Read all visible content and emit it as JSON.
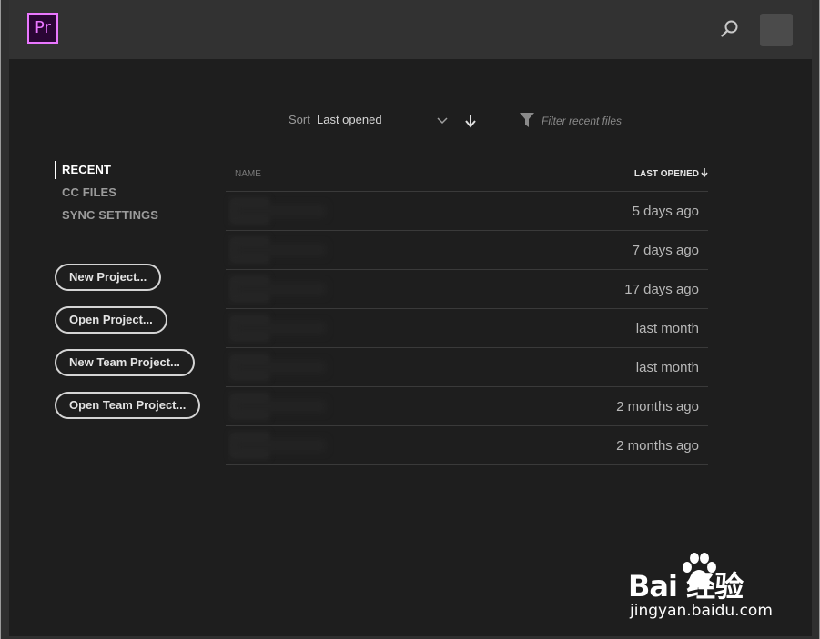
{
  "app": {
    "logo_text": "Pr",
    "accent_color": "#ea77ff"
  },
  "header": {
    "search_icon": "search-icon",
    "avatar_icon": "user-avatar"
  },
  "sort": {
    "label": "Sort",
    "selected": "Last opened",
    "direction": "descending"
  },
  "filter": {
    "placeholder": "Filter recent files"
  },
  "nav": {
    "items": [
      {
        "label": "RECENT",
        "active": true
      },
      {
        "label": "CC FILES",
        "active": false
      },
      {
        "label": "SYNC SETTINGS",
        "active": false
      }
    ]
  },
  "actions": {
    "new_project": "New Project...",
    "open_project": "Open Project...",
    "new_team_project": "New Team Project...",
    "open_team_project": "Open Team Project..."
  },
  "table": {
    "col_name": "NAME",
    "col_last_opened": "LAST OPENED",
    "rows": [
      {
        "date": "5 days ago"
      },
      {
        "date": "7 days ago"
      },
      {
        "date": "17 days ago"
      },
      {
        "date": "last month"
      },
      {
        "date": "last month"
      },
      {
        "date": "2 months ago"
      },
      {
        "date": "2 months ago"
      }
    ]
  },
  "watermark": {
    "logo": "Bai  经验",
    "url": "jingyan.baidu.com"
  }
}
